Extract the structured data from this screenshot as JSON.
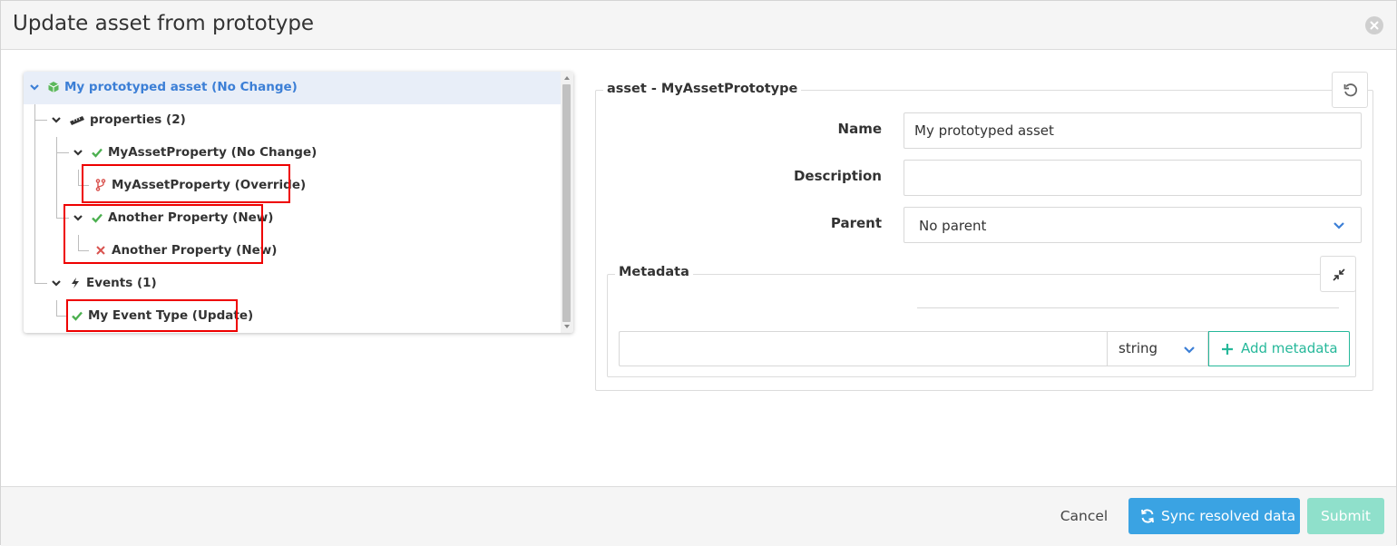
{
  "modal": {
    "title": "Update asset from prototype"
  },
  "tree": {
    "root": {
      "label": "My prototyped asset (No Change)",
      "icon": "cube-icon",
      "color": "#3c7fd6"
    },
    "properties_group": {
      "label": "properties (2)",
      "icon": "ruler-icon"
    },
    "items": [
      {
        "label": "MyAssetProperty (No Change)",
        "icon": "check-icon",
        "status_color": "#4cb050"
      },
      {
        "label": "MyAssetProperty (Override)",
        "icon": "code-fork-icon",
        "status_color": "#d9534f"
      },
      {
        "label": "Another Property (New)",
        "icon": "check-icon",
        "status_color": "#4cb050"
      },
      {
        "label": "Another Property (New)",
        "icon": "x-icon",
        "status_color": "#d9534f"
      }
    ],
    "events_group": {
      "label": "Events (1)",
      "icon": "bolt-icon"
    },
    "event_items": [
      {
        "label": "My Event Type (Update)",
        "icon": "check-icon",
        "status_color": "#4cb050"
      }
    ]
  },
  "form": {
    "legend": "asset - MyAssetPrototype",
    "name_label": "Name",
    "name_value": "My prototyped asset",
    "description_label": "Description",
    "description_value": "",
    "parent_label": "Parent",
    "parent_value": "No parent"
  },
  "metadata": {
    "legend": "Metadata",
    "key_value": "",
    "type_value": "string",
    "add_label": "Add metadata"
  },
  "footer": {
    "cancel_label": "Cancel",
    "sync_label": "Sync resolved data",
    "submit_label": "Submit"
  },
  "colors": {
    "accent_blue": "#3aa3e3",
    "accent_green": "#26b89a",
    "highlight_red": "#ee0000"
  }
}
